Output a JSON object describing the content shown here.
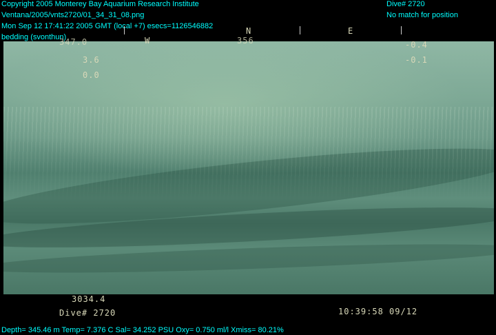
{
  "overlay": {
    "copyright": "Copyright 2005 Monterey Bay Aquarium Research Institute",
    "file": "Ventana/2005/vnts2720/01_34_31_08.png",
    "datetime": "Mon Sep 12 17:41:22 2005 GMT (local +7)  esecs=1126546882",
    "annotation": "bedding (svonthun)",
    "dive_label": "Dive# 2720",
    "position_note": "No match for position",
    "sensors": "Depth= 345.46 m  Temp= 7.376 C  Sal= 34.252 PSU  Oxy= 0.750 ml/l  Xmiss= 80.21%"
  },
  "camera_overlay": {
    "compass_n": "N",
    "compass_e": "E",
    "compass_w": "W",
    "heading_value": "356",
    "top_left_value": "347.0",
    "left_val_1": "3.6",
    "left_val_2": "0.0",
    "right_val_1": "-0.4",
    "right_val_2": "-0.1",
    "depth_readout": "3034.4",
    "dive_stamp": "Dive# 2720",
    "timestamp": "10:39:58 09/12"
  }
}
